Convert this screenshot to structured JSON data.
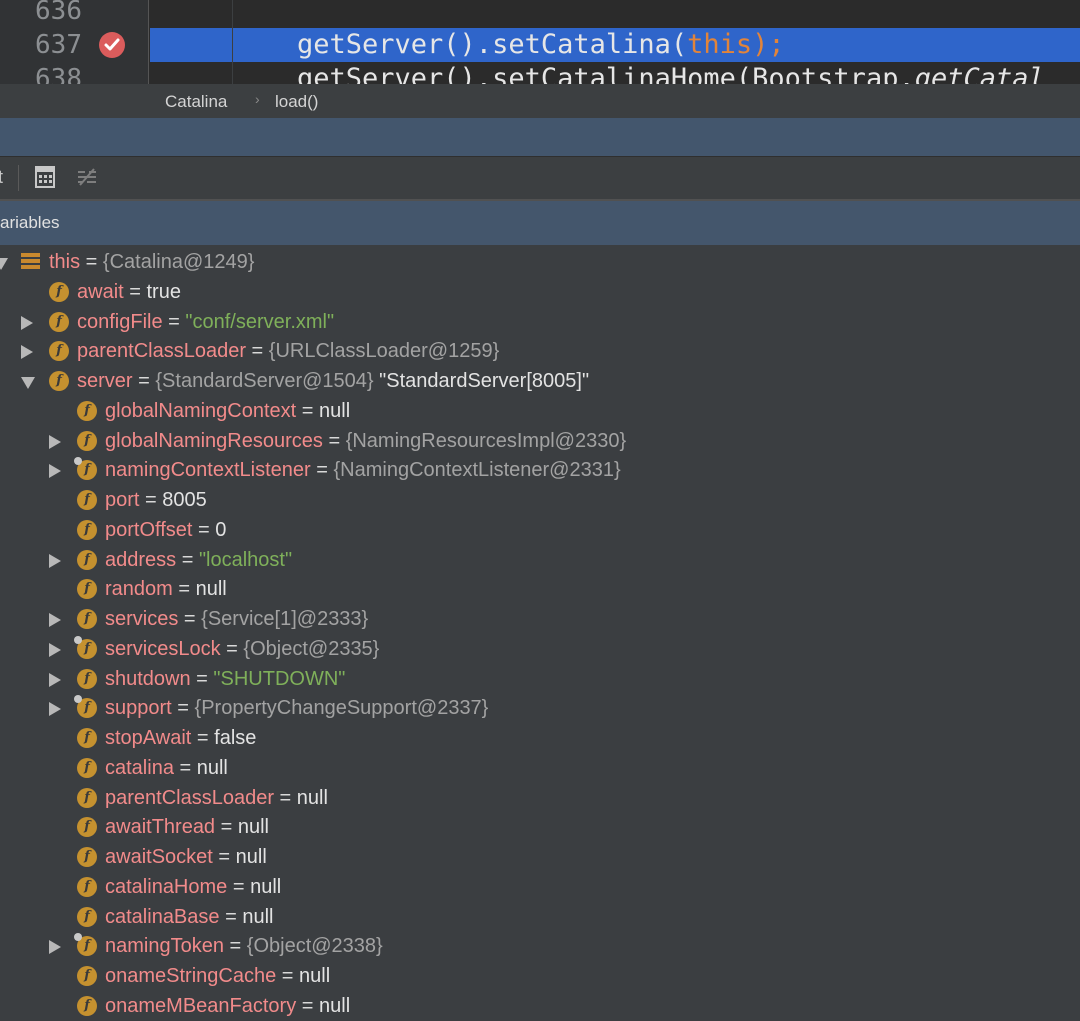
{
  "editor": {
    "lines": [
      {
        "number": "636",
        "code": ""
      },
      {
        "number": "637",
        "code_prefix": "getServer().setCatalina(",
        "code_kw": "this",
        "code_suffix": ");"
      },
      {
        "number": "638",
        "code_prefix": "getServer().setCatalinaHome(Bootstrap.",
        "code_italic": "getCatal"
      }
    ]
  },
  "breadcrumb": {
    "items": [
      "Catalina",
      "load()"
    ],
    "separator": "›"
  },
  "toolbar": {
    "left_glyph": "t"
  },
  "variables_panel": {
    "title": "ariables"
  },
  "colors": {
    "accent": "#2f65ca",
    "field_name": "#f28b8b",
    "string": "#7fb05a",
    "breakpoint": "#db5c5c",
    "field_icon": "#c5912f"
  },
  "tree": [
    {
      "name": "this",
      "eq": " = ",
      "value": "{Catalina@1249}",
      "value_type": "ref",
      "icon": "object-icon",
      "expand": "down",
      "depth": 0
    },
    {
      "name": "await",
      "eq": " = ",
      "value": "true",
      "value_type": "plain",
      "icon": "field-icon",
      "expand": "",
      "depth": 1
    },
    {
      "name": "configFile",
      "eq": " = ",
      "value": "\"conf/server.xml\"",
      "value_type": "str",
      "icon": "field-icon",
      "expand": "right",
      "depth": 1
    },
    {
      "name": "parentClassLoader",
      "eq": " = ",
      "value": "{URLClassLoader@1259}",
      "value_type": "ref",
      "icon": "field-icon",
      "expand": "right",
      "depth": 1
    },
    {
      "name": "server",
      "eq": " = ",
      "value": "{StandardServer@1504}",
      "value_type": "ref",
      "extra": " \"StandardServer[8005]\"",
      "icon": "field-icon",
      "expand": "down",
      "depth": 1
    },
    {
      "name": "globalNamingContext",
      "eq": " = ",
      "value": "null",
      "value_type": "plain",
      "icon": "field-icon",
      "expand": "",
      "depth": 2
    },
    {
      "name": "globalNamingResources",
      "eq": " = ",
      "value": "{NamingResourcesImpl@2330}",
      "value_type": "ref",
      "icon": "field-icon",
      "expand": "right",
      "depth": 2
    },
    {
      "name": "namingContextListener",
      "eq": " = ",
      "value": "{NamingContextListener@2331}",
      "value_type": "ref",
      "icon": "field-icon",
      "pin": true,
      "expand": "right",
      "depth": 2
    },
    {
      "name": "port",
      "eq": " = ",
      "value": "8005",
      "value_type": "plain",
      "icon": "field-icon",
      "expand": "",
      "depth": 2
    },
    {
      "name": "portOffset",
      "eq": " = ",
      "value": "0",
      "value_type": "plain",
      "icon": "field-icon",
      "expand": "",
      "depth": 2
    },
    {
      "name": "address",
      "eq": " = ",
      "value": "\"localhost\"",
      "value_type": "str",
      "icon": "field-icon",
      "expand": "right",
      "depth": 2
    },
    {
      "name": "random",
      "eq": " = ",
      "value": "null",
      "value_type": "plain",
      "icon": "field-icon",
      "expand": "",
      "depth": 2
    },
    {
      "name": "services",
      "eq": " = ",
      "value": "{Service[1]@2333}",
      "value_type": "ref",
      "icon": "field-icon",
      "expand": "right",
      "depth": 2
    },
    {
      "name": "servicesLock",
      "eq": " = ",
      "value": "{Object@2335}",
      "value_type": "ref",
      "icon": "field-icon",
      "pin": true,
      "expand": "right",
      "depth": 2
    },
    {
      "name": "shutdown",
      "eq": " = ",
      "value": "\"SHUTDOWN\"",
      "value_type": "str",
      "icon": "field-icon",
      "expand": "right",
      "depth": 2
    },
    {
      "name": "support",
      "eq": " = ",
      "value": "{PropertyChangeSupport@2337}",
      "value_type": "ref",
      "icon": "field-icon",
      "pin": true,
      "expand": "right",
      "depth": 2
    },
    {
      "name": "stopAwait",
      "eq": " = ",
      "value": "false",
      "value_type": "plain",
      "icon": "field-icon",
      "expand": "",
      "depth": 2
    },
    {
      "name": "catalina",
      "eq": " = ",
      "value": "null",
      "value_type": "plain",
      "icon": "field-icon",
      "expand": "",
      "depth": 2
    },
    {
      "name": "parentClassLoader",
      "eq": " = ",
      "value": "null",
      "value_type": "plain",
      "icon": "field-icon",
      "expand": "",
      "depth": 2
    },
    {
      "name": "awaitThread",
      "eq": " = ",
      "value": "null",
      "value_type": "plain",
      "icon": "field-icon",
      "expand": "",
      "depth": 2
    },
    {
      "name": "awaitSocket",
      "eq": " = ",
      "value": "null",
      "value_type": "plain",
      "icon": "field-icon",
      "expand": "",
      "depth": 2
    },
    {
      "name": "catalinaHome",
      "eq": " = ",
      "value": "null",
      "value_type": "plain",
      "icon": "field-icon",
      "expand": "",
      "depth": 2
    },
    {
      "name": "catalinaBase",
      "eq": " = ",
      "value": "null",
      "value_type": "plain",
      "icon": "field-icon",
      "expand": "",
      "depth": 2
    },
    {
      "name": "namingToken",
      "eq": " = ",
      "value": "{Object@2338}",
      "value_type": "ref",
      "icon": "field-icon",
      "pin": true,
      "expand": "right",
      "depth": 2
    },
    {
      "name": "onameStringCache",
      "eq": " = ",
      "value": "null",
      "value_type": "plain",
      "icon": "field-icon",
      "expand": "",
      "depth": 2
    },
    {
      "name": "onameMBeanFactory",
      "eq": " = ",
      "value": "null",
      "value_type": "plain",
      "icon": "field-icon",
      "expand": "",
      "depth": 2
    }
  ]
}
